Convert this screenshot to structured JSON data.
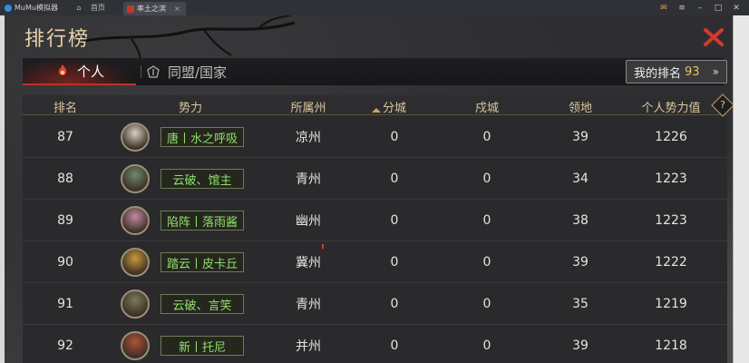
{
  "emulator": {
    "app_title": "MuMu模拟器",
    "home_label": "首页",
    "game_tab_label": "率土之滨",
    "controls": [
      "mail-icon",
      "menu-icon",
      "minimize-icon",
      "maximize-icon",
      "close-icon"
    ]
  },
  "window": {
    "title": "排行榜"
  },
  "tabs": [
    {
      "label": "个人",
      "active": true,
      "icon": "flame-emblem-icon"
    },
    {
      "label": "同盟/国家",
      "active": false,
      "icon": "alliance-emblem-icon"
    }
  ],
  "my_rank": {
    "label": "我的排名",
    "value": "93",
    "arrow": "»"
  },
  "columns": [
    "排名",
    "势力",
    "所属州",
    "分城",
    "戍城",
    "领地",
    "个人势力值"
  ],
  "help_label": "?",
  "rows": [
    {
      "rank": "87",
      "faction": "唐丨水之呼吸",
      "state": "凉州",
      "branch": "0",
      "garrison": "0",
      "territory": "39",
      "power": "1226",
      "avatar_color": "#d9cfc0"
    },
    {
      "rank": "88",
      "faction": "云破、馆主",
      "state": "青州",
      "branch": "0",
      "garrison": "0",
      "territory": "34",
      "power": "1223",
      "avatar_color": "#6e8a6a"
    },
    {
      "rank": "89",
      "faction": "陷阵丨落雨酱",
      "state": "幽州",
      "branch": "0",
      "garrison": "0",
      "territory": "38",
      "power": "1223",
      "avatar_color": "#c08aa0"
    },
    {
      "rank": "90",
      "faction": "踏云丨皮卡丘",
      "state": "冀州",
      "branch": "0",
      "garrison": "0",
      "territory": "39",
      "power": "1222",
      "avatar_color": "#c79a3a"
    },
    {
      "rank": "91",
      "faction": "云破、言笑",
      "state": "青州",
      "branch": "0",
      "garrison": "0",
      "territory": "35",
      "power": "1219",
      "avatar_color": "#7c7a5a"
    },
    {
      "rank": "92",
      "faction": "新丨托尼",
      "state": "并州",
      "branch": "0",
      "garrison": "0",
      "territory": "39",
      "power": "1218",
      "avatar_color": "#b0503a"
    }
  ]
}
